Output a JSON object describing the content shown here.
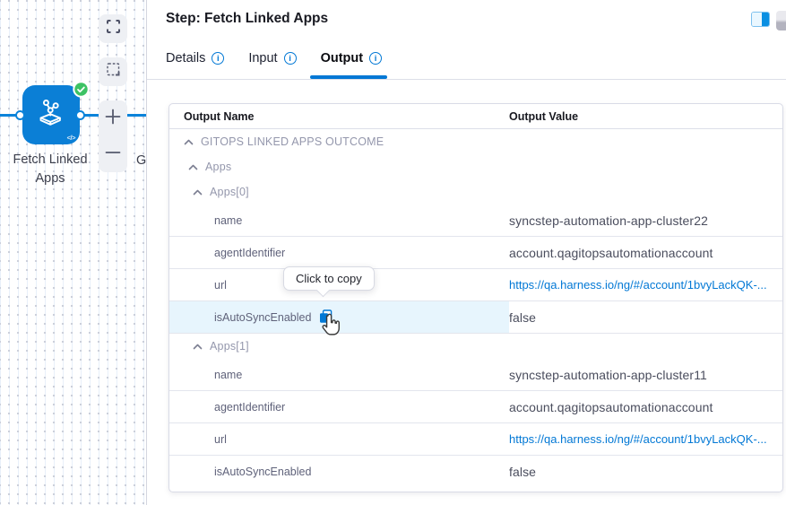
{
  "canvas": {
    "node": {
      "label": "Fetch Linked Apps",
      "status": "success",
      "icon": "gitops-app-icon",
      "code_glyph": "</>"
    },
    "next_node_label": "G",
    "toolbar": [
      {
        "icon": "fullscreen-icon"
      },
      {
        "icon": "marquee-select-icon"
      },
      {
        "icon": "zoom-in-icon"
      },
      {
        "icon": "zoom-out-icon"
      }
    ]
  },
  "panel": {
    "title": "Step: Fetch Linked Apps",
    "header_icons": [
      {
        "icon": "split-panel-icon"
      }
    ],
    "tabs": [
      {
        "label": "Details",
        "active": false
      },
      {
        "label": "Input",
        "active": false
      },
      {
        "label": "Output",
        "active": true
      }
    ],
    "table": {
      "columns": [
        "Output Name",
        "Output Value"
      ],
      "rows": [
        {
          "type": "group",
          "level": 1,
          "label": "GITOPS LINKED APPS OUTCOME"
        },
        {
          "type": "group",
          "level": 2,
          "label": "Apps"
        },
        {
          "type": "group",
          "level": 3,
          "label": "Apps[0]"
        },
        {
          "type": "kv",
          "label": "name",
          "value": "syncstep-automation-app-cluster22",
          "divider": true
        },
        {
          "type": "kv",
          "label": "agentIdentifier",
          "value": "account.qagitopsautomationaccount",
          "divider": true
        },
        {
          "type": "kv",
          "label": "url",
          "value": "https://qa.harness.io/ng/#/account/1bvyLackQK-...",
          "link": true,
          "divider": true
        },
        {
          "type": "kv",
          "label": "isAutoSyncEnabled",
          "value": "false",
          "highlighted": true,
          "copy_icon": true,
          "divider": true
        },
        {
          "type": "group",
          "level": 3,
          "label": "Apps[1]"
        },
        {
          "type": "kv",
          "label": "name",
          "value": "syncstep-automation-app-cluster11",
          "divider": true
        },
        {
          "type": "kv",
          "label": "agentIdentifier",
          "value": "account.qagitopsautomationaccount",
          "divider": true
        },
        {
          "type": "kv",
          "label": "url",
          "value": "https://qa.harness.io/ng/#/account/1bvyLackQK-...",
          "link": true,
          "divider": true
        },
        {
          "type": "kv",
          "label": "isAutoSyncEnabled",
          "value": "false",
          "divider": false
        }
      ]
    }
  },
  "tooltip": {
    "text": "Click to copy"
  },
  "colors": {
    "accent_blue": "#0278d5",
    "success_green": "#3dc264",
    "link_blue": "#0278d5",
    "row_highlight": "#e7f5fd"
  }
}
